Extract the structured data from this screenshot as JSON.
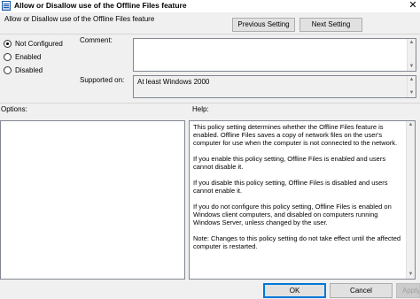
{
  "window": {
    "title": "Allow or Disallow use of the Offline Files feature",
    "close_glyph": "✕"
  },
  "header": {
    "policy_name": "Allow or Disallow use of the Offline Files feature",
    "previous_label": "Previous Setting",
    "next_label": "Next Setting"
  },
  "state": {
    "options": [
      {
        "label": "Not Configured",
        "checked": true
      },
      {
        "label": "Enabled",
        "checked": false
      },
      {
        "label": "Disabled",
        "checked": false
      }
    ]
  },
  "comment": {
    "label": "Comment:",
    "value": ""
  },
  "supported": {
    "label": "Supported on:",
    "value": "At least Windows 2000"
  },
  "options_panel": {
    "label": "Options:"
  },
  "help_panel": {
    "label": "Help:",
    "paragraphs": [
      "This policy setting determines whether the Offline Files feature is enabled. Offline Files saves a copy of network files on the user's computer for use when the computer is not connected to the network.",
      "If you enable this policy setting, Offline Files is enabled and users cannot disable it.",
      "If you disable this policy setting, Offline Files is disabled and users cannot enable it.",
      "If you do not configure this policy setting, Offline Files is enabled on Windows client computers, and disabled on computers running Windows Server, unless changed by the user.",
      "Note: Changes to this policy setting do not take effect until the affected computer is restarted."
    ]
  },
  "footer": {
    "ok_label": "OK",
    "cancel_label": "Cancel",
    "apply_label": "Apply"
  }
}
